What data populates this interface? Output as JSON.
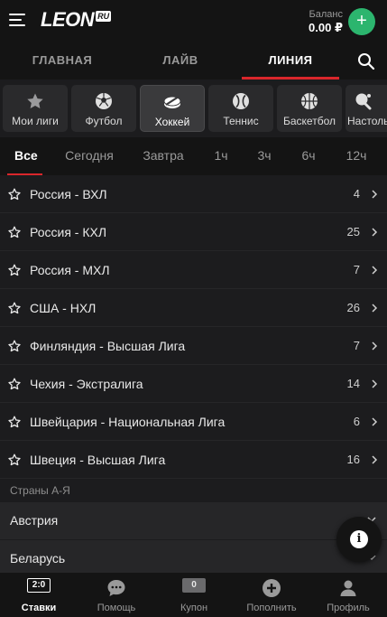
{
  "header": {
    "logo": "LEON",
    "logo_suffix": "RU",
    "balance_label": "Баланс",
    "balance_value": "0.00 ₽",
    "deposit_symbol": "+"
  },
  "nav": {
    "tabs": [
      {
        "label": "ГЛАВНАЯ",
        "active": false
      },
      {
        "label": "ЛАЙВ",
        "active": false
      },
      {
        "label": "ЛИНИЯ",
        "active": true
      }
    ]
  },
  "sports": [
    {
      "label": "Мои лиги",
      "icon": "star-icon"
    },
    {
      "label": "Футбол",
      "icon": "soccer-ball-icon"
    },
    {
      "label": "Хоккей",
      "icon": "hockey-puck-icon",
      "active": true
    },
    {
      "label": "Теннис",
      "icon": "tennis-ball-icon"
    },
    {
      "label": "Баскетбол",
      "icon": "basketball-icon"
    },
    {
      "label": "Настольный",
      "icon": "table-tennis-icon"
    }
  ],
  "periods": [
    {
      "label": "Все",
      "active": true
    },
    {
      "label": "Сегодня"
    },
    {
      "label": "Завтра"
    },
    {
      "label": "1ч"
    },
    {
      "label": "3ч"
    },
    {
      "label": "6ч"
    },
    {
      "label": "12ч"
    }
  ],
  "leagues": [
    {
      "name": "Россия - ВХЛ",
      "count": "4"
    },
    {
      "name": "Россия - КХЛ",
      "count": "25"
    },
    {
      "name": "Россия - МХЛ",
      "count": "7"
    },
    {
      "name": "США - НХЛ",
      "count": "26"
    },
    {
      "name": "Финляндия - Высшая Лига",
      "count": "7"
    },
    {
      "name": "Чехия - Экстралига",
      "count": "14"
    },
    {
      "name": "Швейцария - Национальная Лига",
      "count": "6"
    },
    {
      "name": "Швеция - Высшая Лига",
      "count": "16"
    }
  ],
  "countries": {
    "title": "Страны А-Я",
    "items": [
      {
        "name": "Австрия"
      },
      {
        "name": "Беларусь"
      }
    ]
  },
  "fab": {
    "symbol": "i",
    "icon": "info-icon"
  },
  "bottom_bar": {
    "items": [
      {
        "label": "Ставки",
        "badge": "2:0",
        "icon": "score-icon",
        "active": true
      },
      {
        "label": "Помощь",
        "icon": "chat-icon"
      },
      {
        "label": "Купон",
        "badge": "0",
        "icon": "coupon-icon"
      },
      {
        "label": "Пополнить",
        "icon": "plus-circle-icon"
      },
      {
        "label": "Профиль",
        "icon": "user-icon"
      }
    ]
  },
  "colors": {
    "accent": "#d9262b",
    "deposit": "#2cb56e",
    "background": "#1c1c1e",
    "bar": "#141414"
  }
}
